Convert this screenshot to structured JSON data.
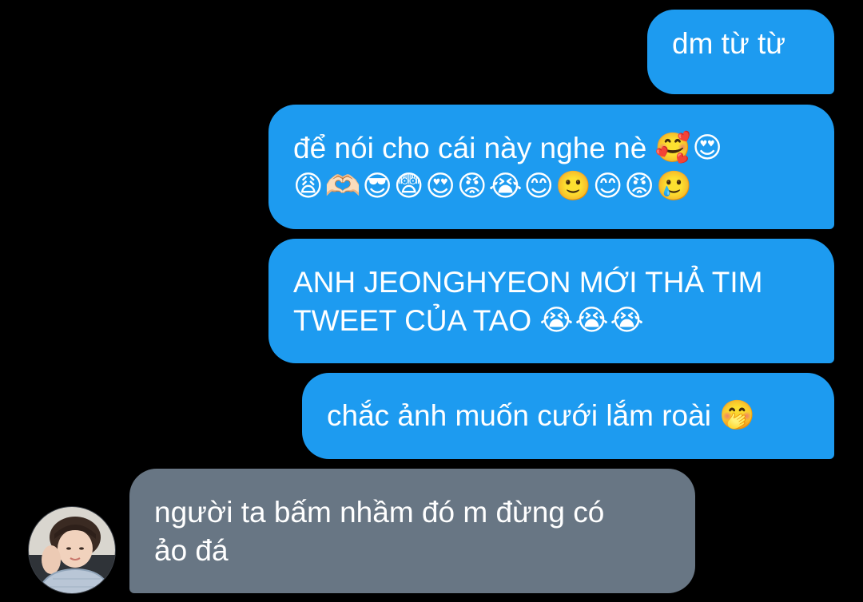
{
  "thread": {
    "messages": [
      {
        "direction": "sent",
        "lines": [
          "dm từ từ"
        ]
      },
      {
        "direction": "sent",
        "lines": [
          "để nói cho cái này nghe nè"
        ],
        "emoji_line1": "🥰😍",
        "emoji_line2": "😩🫶🏻😎😨😍😡😭😊🙂😊😡🥲"
      },
      {
        "direction": "sent",
        "lines": [
          "ANH JEONGHYEON MỚI THẢ TIM",
          "TWEET CỦA TAO"
        ],
        "emoji_line2": "😭😭😭"
      },
      {
        "direction": "sent",
        "lines": [
          "chắc ảnh muốn cưới lắm roài"
        ],
        "emoji_line1": "🤭"
      },
      {
        "direction": "received",
        "lines": [
          "người ta bấm nhầm đó m đừng có",
          "ảo đá"
        ]
      }
    ]
  },
  "colors": {
    "background": "#000000",
    "sent_bubble": "#1d9bf0",
    "received_bubble": "#687684",
    "text": "#ffffff"
  }
}
